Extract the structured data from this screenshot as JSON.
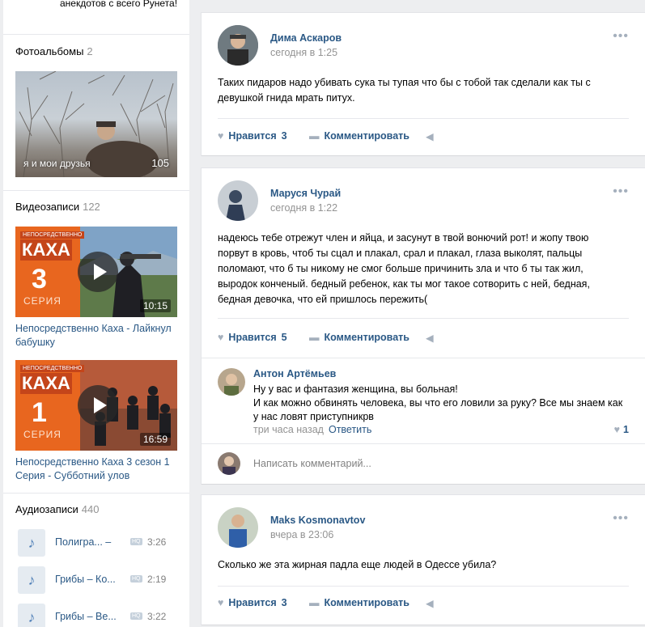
{
  "sidebar": {
    "top_text": "анекдотов с всего Рунета!",
    "photos": {
      "label": "Фотоальбомы",
      "count": "2",
      "album_caption": "я и мои друзья",
      "album_count": "105"
    },
    "videos": {
      "label": "Видеозаписи",
      "count": "122",
      "items": [
        {
          "brand_small": "НЕПОСРЕДСТВЕННО",
          "brand": "КАХА",
          "number": "3",
          "seria": "СЕРИЯ",
          "duration": "10:15",
          "title": "Непосредственно Каха - Лайкнул бабушку"
        },
        {
          "brand_small": "НЕПОСРЕДСТВЕННО",
          "brand": "КАХА",
          "number": "1",
          "seria": "СЕРИЯ",
          "duration": "16:59",
          "title": "Непосредственно Каха 3 сезон 1 Серия - Субботний улов"
        }
      ]
    },
    "audio": {
      "label": "Аудиозаписи",
      "count": "440",
      "items": [
        {
          "title": "Полигра... –",
          "hq": "HQ",
          "time": "3:26"
        },
        {
          "title": "Грибы – Ко...",
          "hq": "HQ",
          "time": "2:19"
        },
        {
          "title": "Грибы – Ве...",
          "hq": "HQ",
          "time": "3:22"
        }
      ]
    }
  },
  "posts": [
    {
      "author": "Дима Аскаров",
      "date": "сегодня в 1:25",
      "text": "Таких пидаров надо убивать сука ты тупая что бы с тобой так сделали как ты с девушкой гнида мрать питух.",
      "like_label": "Нравится",
      "likes": "3",
      "comment_label": "Комментировать"
    },
    {
      "author": "Маруся Чурай",
      "date": "сегодня в 1:22",
      "text": "надеюсь тебе отрежут член и яйца, и засунут в твой вонючий рот! и жопу твою порвут в кровь, чтоб ты сцал и плакал, срал и плакал, глаза выколят, пальцы поломают, что б ты никому не смог больше причинить зла и что б ты так жил, выродок конченый. бедный ребенок, как ты мог такое сотворить с ней, бедная, бедная девочка, что ей пришлось пережить(",
      "like_label": "Нравится",
      "likes": "5",
      "comment_label": "Комментировать",
      "comment": {
        "author": "Антон Артёмьев",
        "text": "Ну у вас и фантазия женщина, вы больная!\nИ как можно обвинять человека, вы что его ловили за руку? Все мы знаем как у нас ловят приступникрв",
        "time": "три часа назад",
        "reply": "Ответить",
        "likes": "1"
      },
      "write_placeholder": "Написать комментарий..."
    },
    {
      "author": "Maks Kosmonavtov",
      "date": "вчера в 23:06",
      "text": "Сколько же эта жирная падла еще людей в Одессе убила?",
      "like_label": "Нравится",
      "likes": "3",
      "comment_label": "Комментировать"
    }
  ],
  "icons": {
    "more": "more-dots-icon",
    "heart": "heart-icon",
    "comment": "comment-icon",
    "share": "share-icon",
    "note": "music-note-icon",
    "play": "play-icon"
  },
  "colors": {
    "link": "#2a5885",
    "muted": "#939393",
    "background": "#edeef0",
    "orange": "#e8661f"
  }
}
